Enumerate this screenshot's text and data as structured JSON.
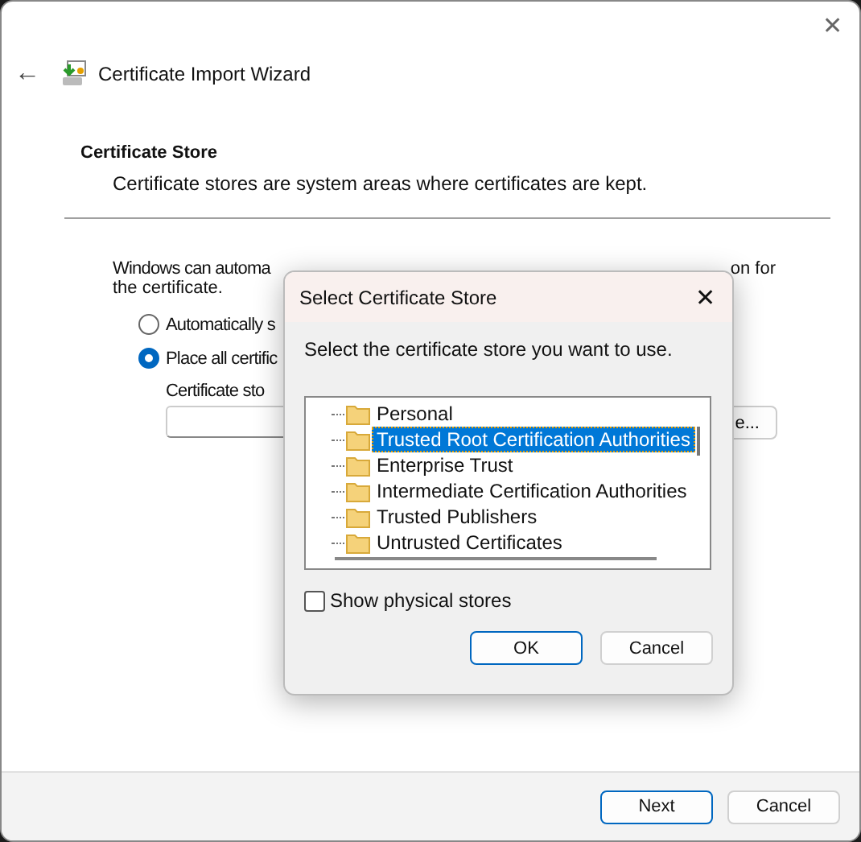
{
  "window": {
    "title": "Certificate Import Wizard",
    "close": "✕",
    "back": "←"
  },
  "section": {
    "heading": "Certificate Store",
    "description": "Certificate stores are system areas where certificates are kept."
  },
  "body": {
    "intro_left": "Windows can automa",
    "intro_right": "on for",
    "intro_line2": "the certificate.",
    "options": [
      {
        "label": "Automatically s",
        "selected": false
      },
      {
        "label": "Place all certific",
        "selected": true
      }
    ],
    "store_label": "Certificate sto",
    "browse": "e..."
  },
  "footer": {
    "buttons": [
      {
        "label": "Next",
        "default": true
      },
      {
        "label": "Cancel",
        "default": false
      }
    ]
  },
  "dialog": {
    "title": "Select Certificate Store",
    "close": "✕",
    "prompt": "Select the certificate store you want to use.",
    "stores": [
      {
        "label": "Personal",
        "selected": false
      },
      {
        "label": "Trusted Root Certification Authorities",
        "selected": true
      },
      {
        "label": "Enterprise Trust",
        "selected": false
      },
      {
        "label": "Intermediate Certification Authorities",
        "selected": false
      },
      {
        "label": "Trusted Publishers",
        "selected": false
      },
      {
        "label": "Untrusted Certificates",
        "selected": false
      }
    ],
    "show_physical": {
      "label": "Show physical stores",
      "checked": false
    },
    "buttons": [
      {
        "label": "OK",
        "default": true
      },
      {
        "label": "Cancel",
        "default": false
      }
    ]
  }
}
